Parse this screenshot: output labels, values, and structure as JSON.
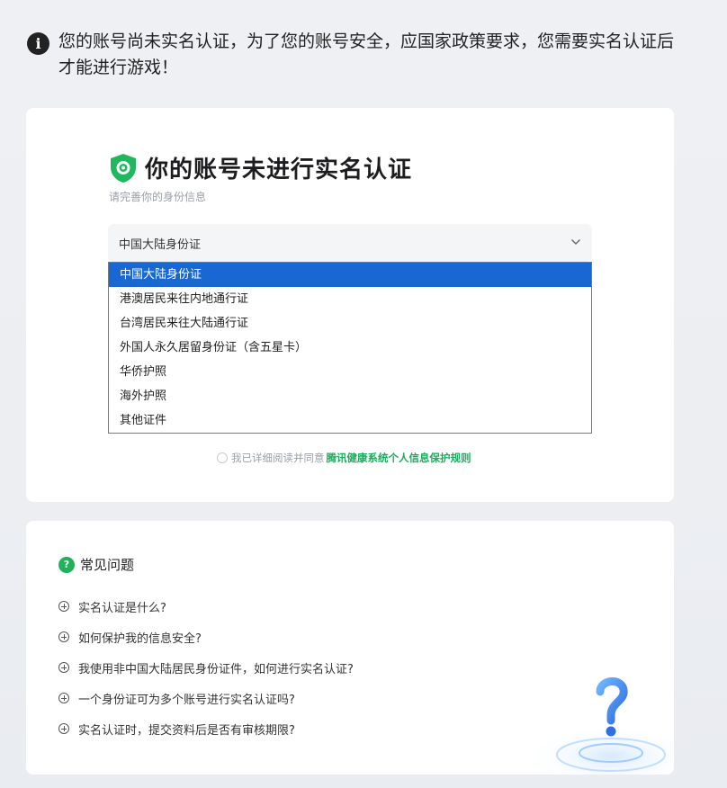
{
  "notice": {
    "icon": "info-icon",
    "text": "您的账号尚未实名认证，为了您的账号安全，应国家政策要求，您需要实名认证后才能进行游戏！"
  },
  "verify": {
    "title": "你的账号未进行实名认证",
    "subtitle": "请完善你的身份信息",
    "id_type_selected": "中国大陆身份证",
    "id_type_options": [
      "中国大陆身份证",
      "港澳居民来往内地通行证",
      "台湾居民来往大陆通行证",
      "外国人永久居留身份证（含五星卡）",
      "华侨护照",
      "海外护照",
      "其他证件"
    ],
    "agree_text": "我已详细阅读并同意",
    "agree_link": "腾讯健康系统个人信息保护规则"
  },
  "faq": {
    "title": "常见问题",
    "items": [
      "实名认证是什么?",
      "如何保护我的信息安全?",
      "我使用非中国大陆居民身份证件，如何进行实名认证?",
      "一个身份证可为多个账号进行实名认证吗?",
      "实名认证时，提交资料后是否有审核期限?"
    ]
  },
  "colors": {
    "accent_green": "#1aad5d",
    "selected_blue": "#1967d2"
  }
}
